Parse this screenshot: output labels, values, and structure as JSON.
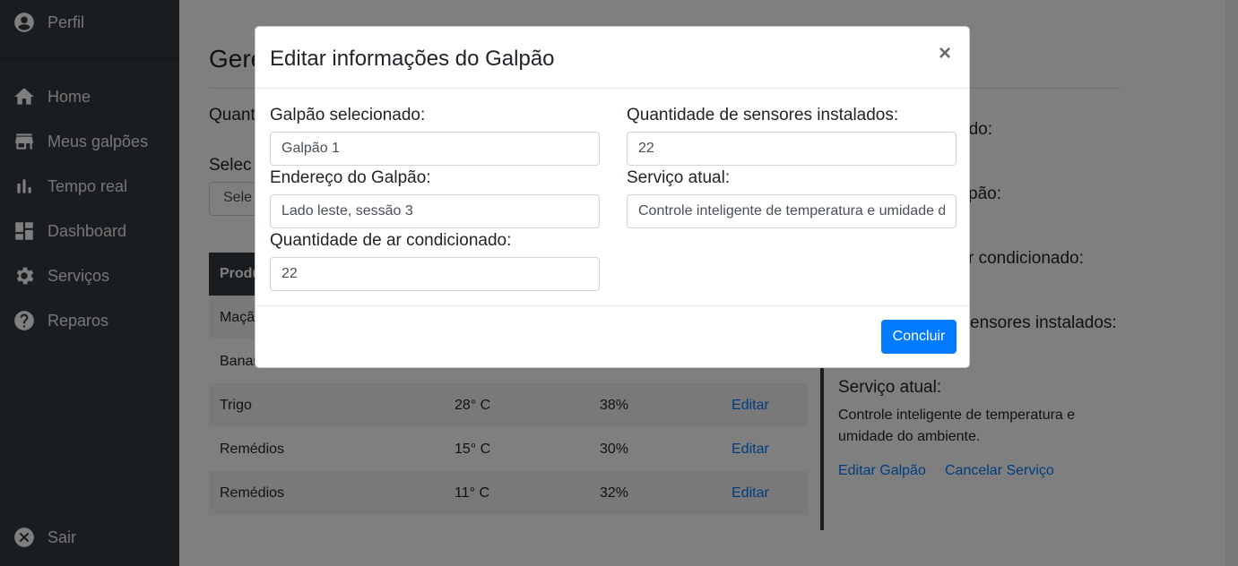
{
  "sidebar": {
    "items": [
      {
        "label": "Perfil",
        "icon": "user-circle-icon"
      },
      {
        "label": "Home",
        "icon": "home-icon"
      },
      {
        "label": "Meus galpões",
        "icon": "warehouse-icon"
      },
      {
        "label": "Tempo real",
        "icon": "bar-chart-icon"
      },
      {
        "label": "Dashboard",
        "icon": "dashboard-icon"
      },
      {
        "label": "Serviços",
        "icon": "gear-icon"
      },
      {
        "label": "Reparos",
        "icon": "help-icon"
      },
      {
        "label": "Sair",
        "icon": "close-circle-icon"
      }
    ]
  },
  "main": {
    "title": "Gere",
    "label_quantity": "Quant",
    "label_select": "Selec",
    "select_placeholder": "Sele",
    "table": {
      "header_first": "Produ",
      "rows": [
        {
          "product": "Maçã",
          "temp": "",
          "humidity": "",
          "action": ""
        },
        {
          "product": "Banan",
          "temp": "",
          "humidity": "",
          "action": ""
        },
        {
          "product": "Trigo",
          "temp": "28° C",
          "humidity": "38%",
          "action": "Editar"
        },
        {
          "product": "Remédios",
          "temp": "15° C",
          "humidity": "30%",
          "action": "Editar"
        },
        {
          "product": "Remédios",
          "temp": "11° C",
          "humidity": "32%",
          "action": "Editar"
        }
      ]
    },
    "info": {
      "partial_selected": "ado:",
      "partial_address": "pão:",
      "partial_ac": "r condicionado:",
      "partial_sensors": "ensores instalados:",
      "service_label": "Serviço atual:",
      "service_text": "Controle inteligente de temperatura e umidade do ambiente.",
      "edit_link": "Editar Galpão",
      "cancel_link": "Cancelar Serviço"
    }
  },
  "modal": {
    "title": "Editar informações do Galpão",
    "close": "×",
    "fields": {
      "selected_label": "Galpão selecionado:",
      "selected_value": "Galpão 1",
      "address_label": "Endereço do Galpão:",
      "address_value": "Lado leste, sessão 3",
      "ac_label": "Quantidade de ar condicionado:",
      "ac_value": "22",
      "sensors_label": "Quantidade de sensores instalados:",
      "sensors_value": "22",
      "service_label": "Serviço atual:",
      "service_value": "Controle inteligente de temperatura e umidade do ambiente."
    },
    "submit_label": "Concluir"
  },
  "colors": {
    "sidebar_bg": "#343a40",
    "primary": "#007bff",
    "backdrop": "rgba(0,0,0,0.5)"
  }
}
